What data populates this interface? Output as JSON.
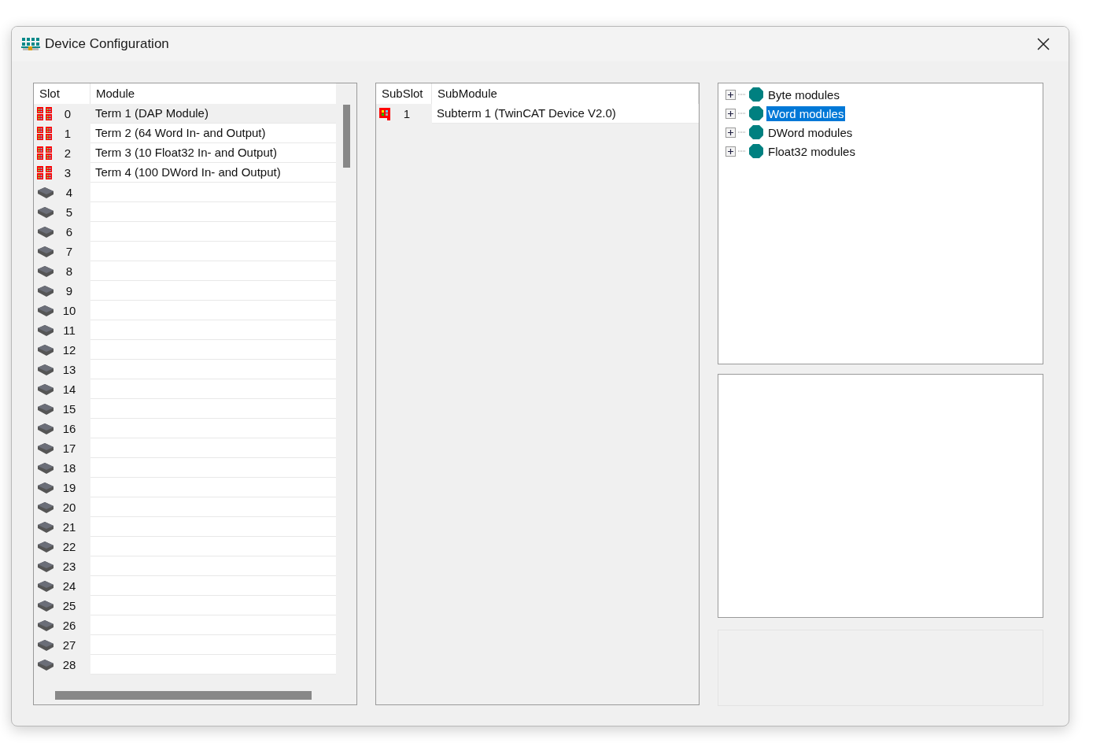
{
  "window": {
    "title": "Device Configuration"
  },
  "slots": {
    "columns": [
      "Slot",
      "Module"
    ],
    "rows": [
      {
        "slot": "0",
        "module": "Term 1 (DAP Module)",
        "kind": "module",
        "selected": true
      },
      {
        "slot": "1",
        "module": "Term 2 (64 Word In- and Output)",
        "kind": "module",
        "selected": false
      },
      {
        "slot": "2",
        "module": "Term 3 (10 Float32 In- and Output)",
        "kind": "module",
        "selected": false
      },
      {
        "slot": "3",
        "module": "Term 4 (100 DWord In- and Output)",
        "kind": "module",
        "selected": false
      },
      {
        "slot": "4",
        "kind": "empty",
        "selected": false
      },
      {
        "slot": "5",
        "kind": "empty",
        "selected": false
      },
      {
        "slot": "6",
        "kind": "empty",
        "selected": false
      },
      {
        "slot": "7",
        "kind": "empty",
        "selected": false
      },
      {
        "slot": "8",
        "kind": "empty",
        "selected": false
      },
      {
        "slot": "9",
        "kind": "empty",
        "selected": false
      },
      {
        "slot": "10",
        "kind": "empty",
        "selected": false
      },
      {
        "slot": "11",
        "kind": "empty",
        "selected": false
      },
      {
        "slot": "12",
        "kind": "empty",
        "selected": false
      },
      {
        "slot": "13",
        "kind": "empty",
        "selected": false
      },
      {
        "slot": "14",
        "kind": "empty",
        "selected": false
      },
      {
        "slot": "15",
        "kind": "empty",
        "selected": false
      },
      {
        "slot": "16",
        "kind": "empty",
        "selected": false
      },
      {
        "slot": "17",
        "kind": "empty",
        "selected": false
      },
      {
        "slot": "18",
        "kind": "empty",
        "selected": false
      },
      {
        "slot": "19",
        "kind": "empty",
        "selected": false
      },
      {
        "slot": "20",
        "kind": "empty",
        "selected": false
      },
      {
        "slot": "21",
        "kind": "empty",
        "selected": false
      },
      {
        "slot": "22",
        "kind": "empty",
        "selected": false
      },
      {
        "slot": "23",
        "kind": "empty",
        "selected": false
      },
      {
        "slot": "24",
        "kind": "empty",
        "selected": false
      },
      {
        "slot": "25",
        "kind": "empty",
        "selected": false
      },
      {
        "slot": "26",
        "kind": "empty",
        "selected": false
      },
      {
        "slot": "27",
        "kind": "empty",
        "selected": false
      },
      {
        "slot": "28",
        "kind": "empty",
        "selected": false
      }
    ]
  },
  "subslots": {
    "columns": [
      "SubSlot",
      "SubModule"
    ],
    "rows": [
      {
        "slot": "1",
        "module": "Subterm 1 (TwinCAT Device V2.0)",
        "kind": "submodule",
        "selected": false
      }
    ]
  },
  "catalog": {
    "items": [
      {
        "label": "Byte modules",
        "expanded": false,
        "selected": false
      },
      {
        "label": "Word modules",
        "expanded": false,
        "selected": true
      },
      {
        "label": "DWord modules",
        "expanded": false,
        "selected": false
      },
      {
        "label": "Float32 modules",
        "expanded": false,
        "selected": false
      }
    ]
  }
}
